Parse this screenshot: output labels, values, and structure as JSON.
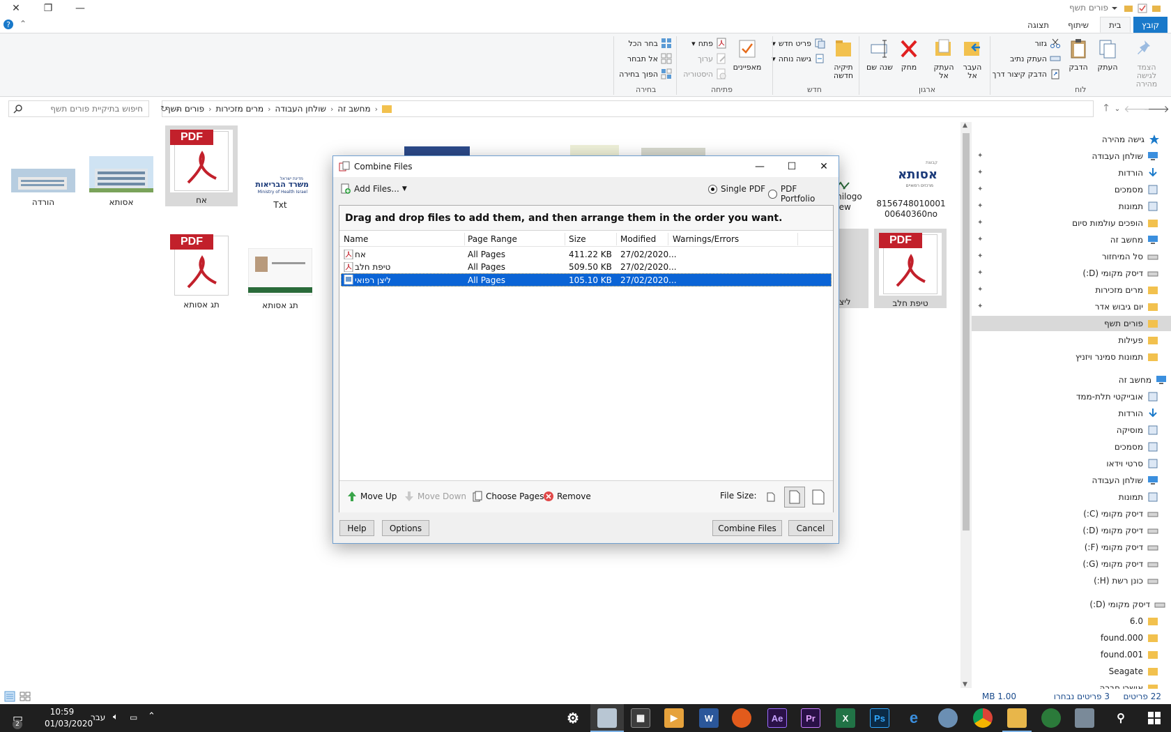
{
  "explorer": {
    "title": "פורים תשף",
    "tabs": {
      "file": "קובץ",
      "home": "בית",
      "share": "שיתוף",
      "view": "תצוגה"
    },
    "ribbon": {
      "clipboard": {
        "label": "לוח",
        "pin": "הצמד לגישה מהירה",
        "copy": "העתק",
        "paste": "הדבק",
        "cut": "גזור",
        "copy_path": "העתק נתיב",
        "paste_shortcut": "הדבק קיצור דרך"
      },
      "organize": {
        "label": "ארגון",
        "move_to": "העבר אל",
        "copy_to": "העתק אל",
        "delete": "מחק",
        "rename": "שנה שם"
      },
      "new": {
        "label": "חדש",
        "new_folder": "תיקיה חדשה",
        "new_item": "פריט חדש",
        "easy_access": "גישה נוחה"
      },
      "open": {
        "label": "פתיחה",
        "properties": "מאפיינים",
        "open": "פתח",
        "edit": "ערוך",
        "history": "היסטוריה"
      },
      "select": {
        "label": "בחירה",
        "select_all": "בחר הכל",
        "select_none": "אל תבחר",
        "invert": "הפוך בחירה"
      }
    },
    "address": {
      "crumbs": [
        "מחשב זה",
        "שולחן העבודה",
        "מרים מזכירות",
        "פורים תשף"
      ]
    },
    "search_placeholder": "חיפוש בתיקיית פורים תשף",
    "nav": {
      "quick_access": "גישה מהירה",
      "quick": [
        "שולחן העבודה",
        "הורדות",
        "מסמכים",
        "תמונות",
        "הופכים עולמות סיום",
        "מחשב זה",
        "סל המיחזור",
        "דיסק מקומי (D:)",
        "מרים מזכירות",
        "יום גיבוש אדר",
        "פורים תשף",
        "פעילות",
        "תמונות סמינר ויזניץ"
      ],
      "this_pc": "מחשב זה",
      "pc": [
        "אובייקטי תלת-ממד",
        "הורדות",
        "מוסיקה",
        "מסמכים",
        "סרטי וידאו",
        "שולחן העבודה",
        "תמונות",
        "דיסק מקומי (C:)",
        "דיסק מקומי (D:)",
        "דיסק מקומי (F:)",
        "דיסק מקומי (G:)",
        "כונן רשת (H:)"
      ],
      "drive_d": "דיסק מקומי (D:)",
      "d_items": [
        "6.0",
        "found.000",
        "found.001",
        "Seagate",
        "אושרי חברה"
      ]
    },
    "files": [
      {
        "name": "הורדה"
      },
      {
        "name": "אסותא"
      },
      {
        "name": "אח"
      },
      {
        "name": "Txt"
      },
      {
        "name": "תג אסותא"
      },
      {
        "name": "תג אסותא"
      },
      {
        "name": "815674801000100640360no"
      },
      {
        "name": "טיפת חלב"
      },
      {
        "name": "milogo new"
      },
      {
        "name": "ליצ"
      }
    ],
    "thumb_texts": {
      "moh_top": "מדינת ישראל",
      "moh_he": "משרד הבריאות",
      "moh_en": "Ministry of Health Israel",
      "assuta_logo": "אסותא",
      "assuta_sub": "מרכזים רפואיים",
      "assuta_top": "קבוצת"
    },
    "status": {
      "count": "22 פריטים",
      "selected": "3 פריטים נבחרו",
      "size": "1.00 MB"
    }
  },
  "dialog": {
    "title": "Combine Files",
    "add_files": "Add Files...",
    "single_pdf": "Single PDF",
    "portfolio": "PDF Portfolio",
    "instruction": "Drag and drop files to add them, and then arrange them in the order you want.",
    "columns": {
      "name": "Name",
      "range": "Page Range",
      "size": "Size",
      "modified": "Modified",
      "warnings": "Warnings/Errors"
    },
    "rows": [
      {
        "name": "אח",
        "range": "All Pages",
        "size": "411.22 KB",
        "modified": "27/02/2020..."
      },
      {
        "name": "טיפת חלב",
        "range": "All Pages",
        "size": "509.50 KB",
        "modified": "27/02/2020..."
      },
      {
        "name": "ליצן רפואי",
        "range": "All Pages",
        "size": "105.10 KB",
        "modified": "27/02/2020..."
      }
    ],
    "move_up": "Move Up",
    "move_down": "Move Down",
    "choose_pages": "Choose Pages",
    "remove": "Remove",
    "file_size": "File Size:",
    "help": "Help",
    "options": "Options",
    "combine": "Combine Files",
    "cancel": "Cancel"
  },
  "taskbar": {
    "time": "10:59",
    "date": "01/03/2020",
    "lang": "עבר",
    "notif_count": "2",
    "apps": {
      "ae": "Ae",
      "pr": "Pr",
      "x": "X",
      "ps": "Ps",
      "w": "W"
    }
  },
  "colors": {
    "accent": "#1979ca",
    "selection": "#0a64d6",
    "pdf_red": "#c2202b"
  }
}
